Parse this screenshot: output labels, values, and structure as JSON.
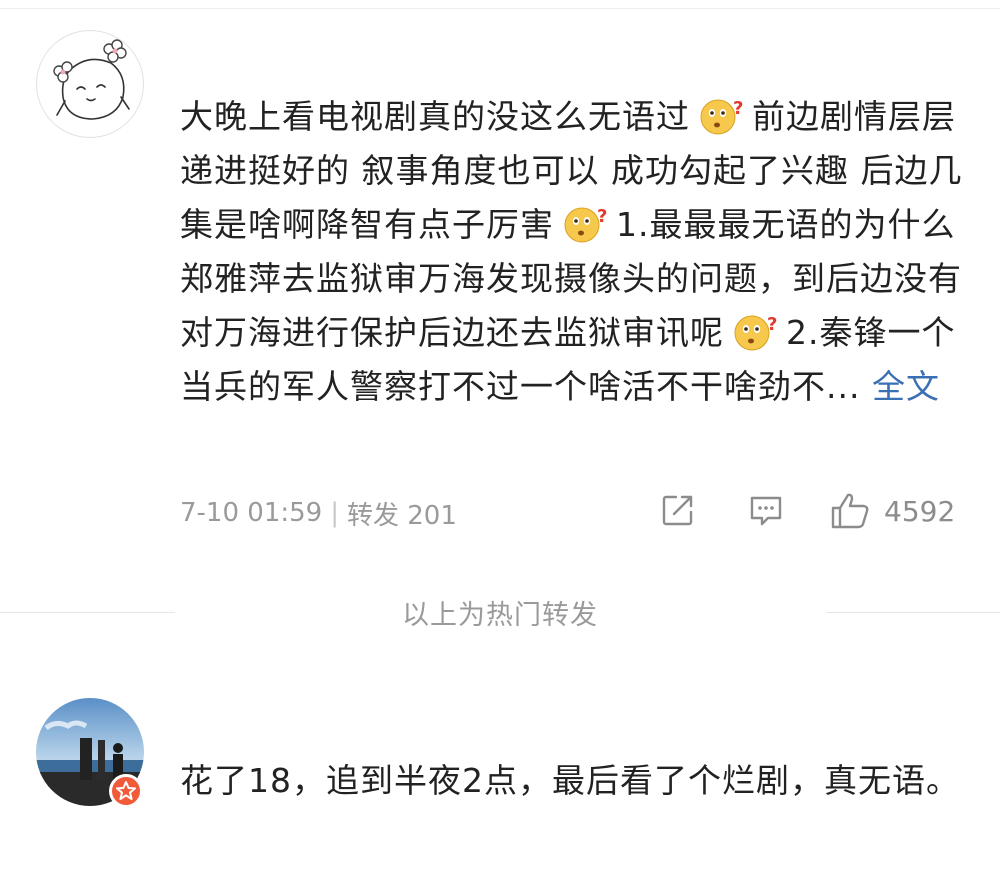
{
  "post1": {
    "avatar_icon": "doodle-avatar-icon",
    "text_segments": [
      "大晚上看电视剧真的没这么无语过",
      "前边剧情层层递进挺好的 叙事角度也可以 成功勾起了兴趣 后边几集是啥啊降智有点子厉害",
      "1.最最最无语的为什么郑雅萍去监狱审万海发现摄像头的问题，到后边没有对万海进行保护后边还去监狱审讯呢",
      "2.秦锋一个当兵的军人警察打不过一个啥活不干啥劲不..."
    ],
    "full_text_link": "全文",
    "timestamp": "7-10 01:59",
    "separator": "|",
    "repost_label": "转发 201",
    "like_count": "4592",
    "emoji_name": "confused-face-icon"
  },
  "hot_repost_label": "以上为热门转发",
  "post2": {
    "text": "花了18，追到半夜2点，最后看了个烂剧，真无语。",
    "badge_color": "#f15b3a"
  },
  "colors": {
    "link": "#3b6fb4",
    "meta": "#9a9a9a"
  }
}
